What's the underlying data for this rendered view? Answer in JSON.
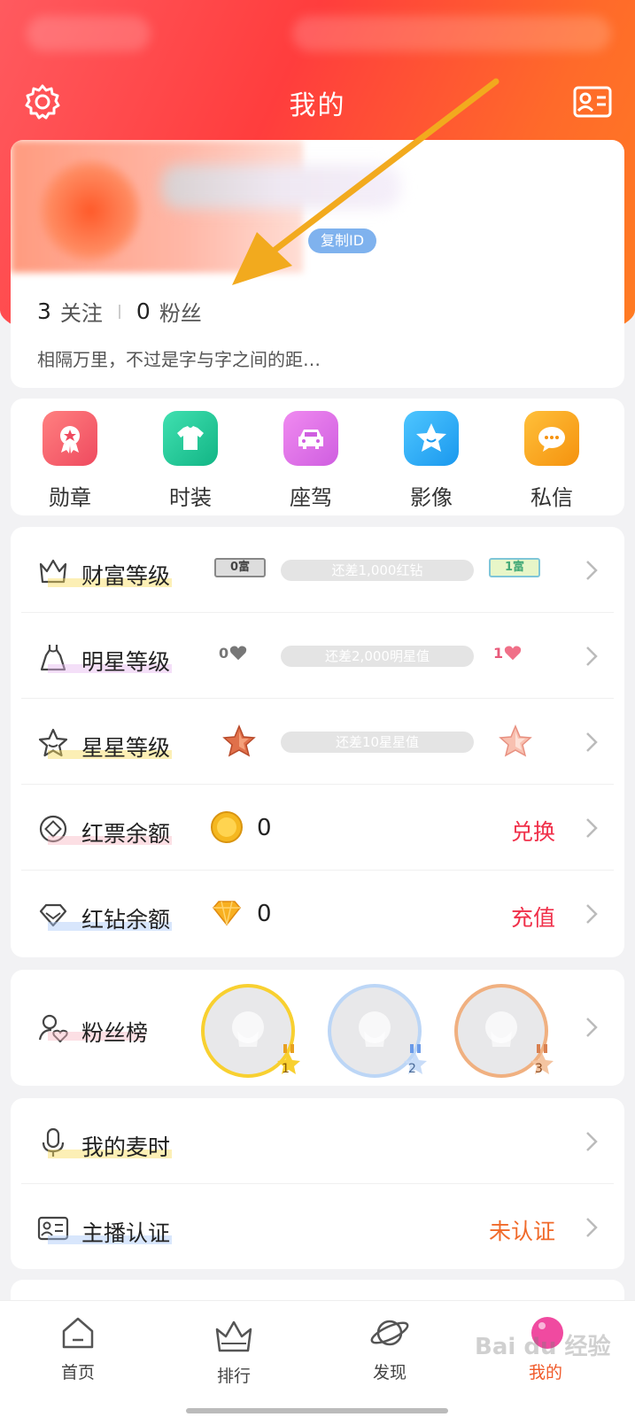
{
  "header": {
    "title": "我的"
  },
  "profile": {
    "copy_id_label": "复制ID",
    "following_count": "3",
    "following_label": "关注",
    "fans_count": "0",
    "fans_label": "粉丝",
    "bio": "相隔万里，不过是字与字之间的距…"
  },
  "shortcuts": [
    {
      "label": "勋章",
      "icon": "medal-icon",
      "color": "#f25a6a"
    },
    {
      "label": "时装",
      "icon": "shirt-icon",
      "color": "#1fc79a"
    },
    {
      "label": "座驾",
      "icon": "car-icon",
      "color": "#e27ae8"
    },
    {
      "label": "影像",
      "icon": "star-icon",
      "color": "#2aaff2"
    },
    {
      "label": "私信",
      "icon": "chat-icon",
      "color": "#f8a21a"
    }
  ],
  "levels": {
    "wealth": {
      "label": "财富等级",
      "current": "0富",
      "next": "1富",
      "progress_text": "还差1,000红钻",
      "progress": 0
    },
    "star": {
      "label": "明星等级",
      "current": "0",
      "next": "1",
      "progress_text": "还差2,000明星值",
      "progress": 0
    },
    "stars": {
      "label": "星星等级",
      "progress_text": "还差10星星值",
      "progress": 0
    },
    "red_ticket": {
      "label": "红票余额",
      "amount": "0",
      "action": "兑换"
    },
    "red_diamond": {
      "label": "红钻余额",
      "amount": "0",
      "action": "充值"
    }
  },
  "fans_board": {
    "label": "粉丝榜",
    "ranks": [
      "1",
      "2",
      "3"
    ]
  },
  "misc": {
    "mic_time": {
      "label": "我的麦时"
    },
    "anchor_cert": {
      "label": "主播认证",
      "status": "未认证"
    }
  },
  "tabs": [
    {
      "label": "首页",
      "icon": "home-icon"
    },
    {
      "label": "排行",
      "icon": "crown-icon"
    },
    {
      "label": "发现",
      "icon": "planet-icon"
    },
    {
      "label": "我的",
      "icon": "profile-icon"
    }
  ],
  "watermark": "Bai du 经验",
  "colors": {
    "accent": "#ff4d3a",
    "action_red": "#f0304a",
    "status_orange": "#f06a2a",
    "arrow": "#f5a623"
  }
}
